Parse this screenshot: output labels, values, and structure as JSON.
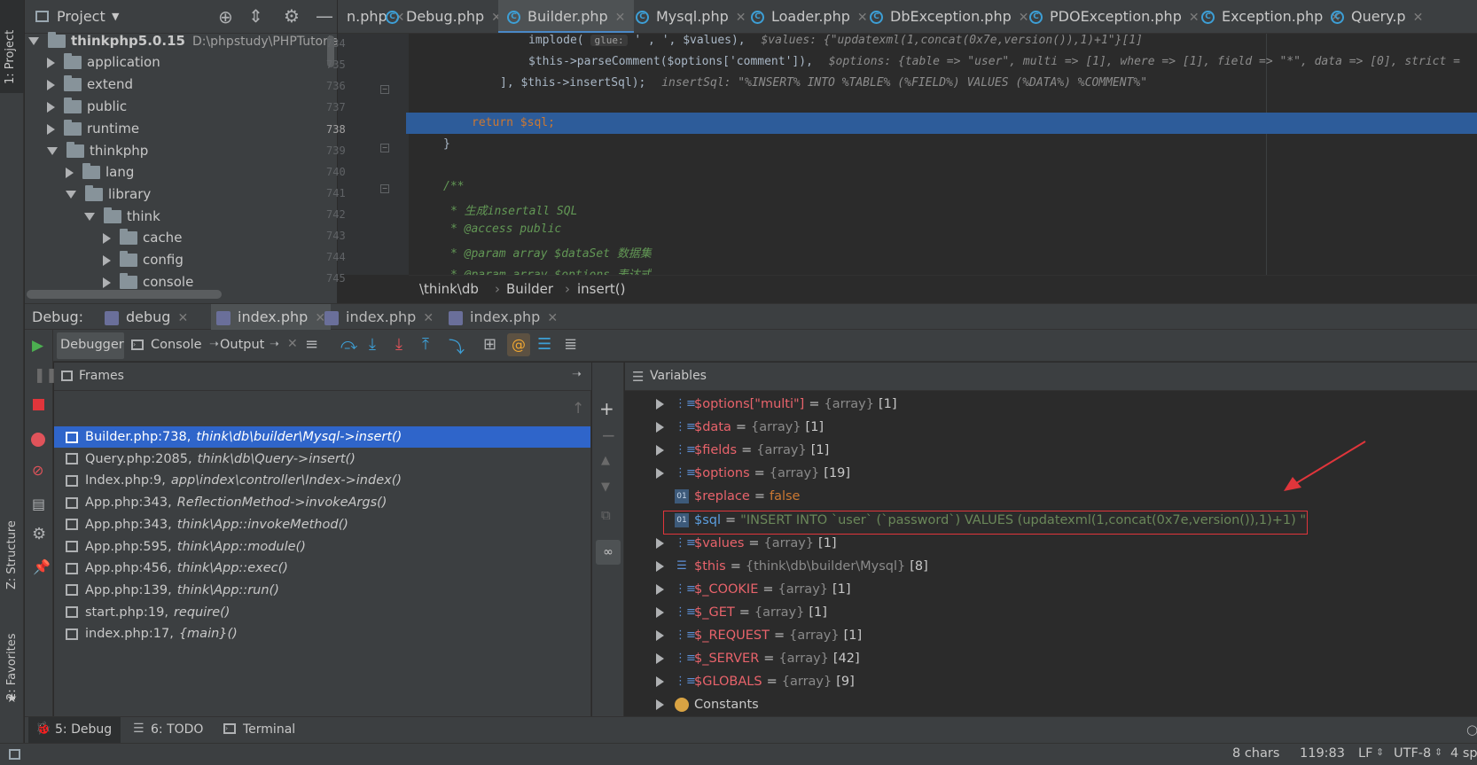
{
  "sidebar_left": {
    "project_label": "1: Project",
    "structure_label": "Z: Structure",
    "favorites_label": "2: Favorites"
  },
  "project_panel": {
    "title": "Project",
    "tree": [
      {
        "label": "thinkphp5.0.15",
        "path": "D:\\phpstudy\\PHPTutorial\\",
        "level": 0,
        "expanded": true,
        "bold": true
      },
      {
        "label": "application",
        "level": 1,
        "expanded": false
      },
      {
        "label": "extend",
        "level": 1,
        "expanded": false
      },
      {
        "label": "public",
        "level": 1,
        "expanded": false
      },
      {
        "label": "runtime",
        "level": 1,
        "expanded": false
      },
      {
        "label": "thinkphp",
        "level": 1,
        "expanded": true
      },
      {
        "label": "lang",
        "level": 2,
        "expanded": false
      },
      {
        "label": "library",
        "level": 2,
        "expanded": true
      },
      {
        "label": "think",
        "level": 3,
        "expanded": true
      },
      {
        "label": "cache",
        "level": 4,
        "expanded": false
      },
      {
        "label": "config",
        "level": 4,
        "expanded": false
      },
      {
        "label": "console",
        "level": 4,
        "expanded": false
      }
    ]
  },
  "editor_tabs": [
    {
      "label": "n.php",
      "active": false
    },
    {
      "label": "Debug.php",
      "active": false
    },
    {
      "label": "Builder.php",
      "active": true
    },
    {
      "label": "Mysql.php",
      "active": false
    },
    {
      "label": "Loader.php",
      "active": false
    },
    {
      "label": "DbException.php",
      "active": false
    },
    {
      "label": "PDOException.php",
      "active": false
    },
    {
      "label": "Exception.php",
      "active": false
    },
    {
      "label": "Query.p",
      "active": false
    }
  ],
  "code": {
    "line_numbers": [
      "734",
      "735",
      "736",
      "737",
      "738",
      "739",
      "740",
      "741",
      "742",
      "743",
      "744",
      "745"
    ],
    "l734_code": "implode(",
    "l734_hint": "glue:",
    "l734_rest": "' , ', $values),",
    "l734_debug": "$values: {\"updatexml(1,concat(0x7e,version()),1)+1\"}[1]",
    "l735_code": "$this->parseComment($options['comment']),",
    "l735_debug": "$options: {table => \"user\", multi => [1], where => [1], field => \"*\", data => [0], strict =",
    "l736_code": "], $this->insertSql);",
    "l736_debug": "insertSql: \"%INSERT% INTO %TABLE% (%FIELD%) VALUES (%DATA%) %COMMENT%\"",
    "l738_code": "return $sql;",
    "l739_code": "}",
    "l741_code": "/**",
    "l742_code": "* 生成insertall SQL",
    "l743_code": "* @access public",
    "l744_code": "* @param array     $dataSet 数据集",
    "l745_code": "* @param array     $options 表达式"
  },
  "breadcrumb": [
    "\\think\\db",
    "Builder",
    "insert()"
  ],
  "debug_bar": {
    "label": "Debug:",
    "tabs": [
      {
        "label": "debug",
        "active": false
      },
      {
        "label": "index.php",
        "active": true
      },
      {
        "label": "index.php",
        "active": false
      },
      {
        "label": "index.php",
        "active": false
      }
    ]
  },
  "debugger_tabs": {
    "debugger": "Debugger",
    "console": "Console",
    "output": "Output"
  },
  "frames": {
    "title": "Frames",
    "items": [
      {
        "loc": "Builder.php:738,",
        "fn": "think\\db\\builder\\Mysql->insert()",
        "selected": true
      },
      {
        "loc": "Query.php:2085,",
        "fn": "think\\db\\Query->insert()"
      },
      {
        "loc": "Index.php:9,",
        "fn": "app\\index\\controller\\Index->index()"
      },
      {
        "loc": "App.php:343,",
        "fn": "ReflectionMethod->invokeArgs()"
      },
      {
        "loc": "App.php:343,",
        "fn": "think\\App::invokeMethod()"
      },
      {
        "loc": "App.php:595,",
        "fn": "think\\App::module()"
      },
      {
        "loc": "App.php:456,",
        "fn": "think\\App::exec()"
      },
      {
        "loc": "App.php:139,",
        "fn": "think\\App::run()"
      },
      {
        "loc": "start.php:19,",
        "fn": "require()"
      },
      {
        "loc": "index.php:17,",
        "fn": "{main}()"
      }
    ]
  },
  "variables": {
    "title": "Variables",
    "items": [
      {
        "name": "$options[\"multi\"]",
        "type": "{array}",
        "count": "[1]",
        "expandable": true
      },
      {
        "name": "$data",
        "type": "{array}",
        "count": "[1]",
        "expandable": true
      },
      {
        "name": "$fields",
        "type": "{array}",
        "count": "[1]",
        "expandable": true
      },
      {
        "name": "$options",
        "type": "{array}",
        "count": "[19]",
        "expandable": true
      },
      {
        "name": "$replace",
        "value": "false",
        "expandable": false
      },
      {
        "name": "$sql",
        "value": "\"INSERT INTO `user` (`password`) VALUES (updatexml(1,concat(0x7e,version()),1)+1) \"",
        "expandable": false,
        "highlighted": true
      },
      {
        "name": "$values",
        "type": "{array}",
        "count": "[1]",
        "expandable": true
      },
      {
        "name": "$this",
        "type": "{think\\db\\builder\\Mysql}",
        "count": "[8]",
        "expandable": true
      },
      {
        "name": "$_COOKIE",
        "type": "{array}",
        "count": "[1]",
        "expandable": true
      },
      {
        "name": "$_GET",
        "type": "{array}",
        "count": "[1]",
        "expandable": true
      },
      {
        "name": "$_REQUEST",
        "type": "{array}",
        "count": "[1]",
        "expandable": true
      },
      {
        "name": "$_SERVER",
        "type": "{array}",
        "count": "[42]",
        "expandable": true
      },
      {
        "name": "$GLOBALS",
        "type": "{array}",
        "count": "[9]",
        "expandable": true
      },
      {
        "name": "Constants",
        "expandable": true,
        "constants": true
      }
    ]
  },
  "bottom_tabs": {
    "debug": "5: Debug",
    "todo": "6: TODO",
    "terminal": "Terminal"
  },
  "status_bar": {
    "chars": "8 chars",
    "position": "119:83",
    "line_sep": "LF",
    "encoding": "UTF-8",
    "indent": "4 sp"
  },
  "colors": {
    "accent_blue": "#2f65ca",
    "highlight_red": "#e0353b",
    "var_name": "#e8636b",
    "selection": "#2d5c9a"
  }
}
